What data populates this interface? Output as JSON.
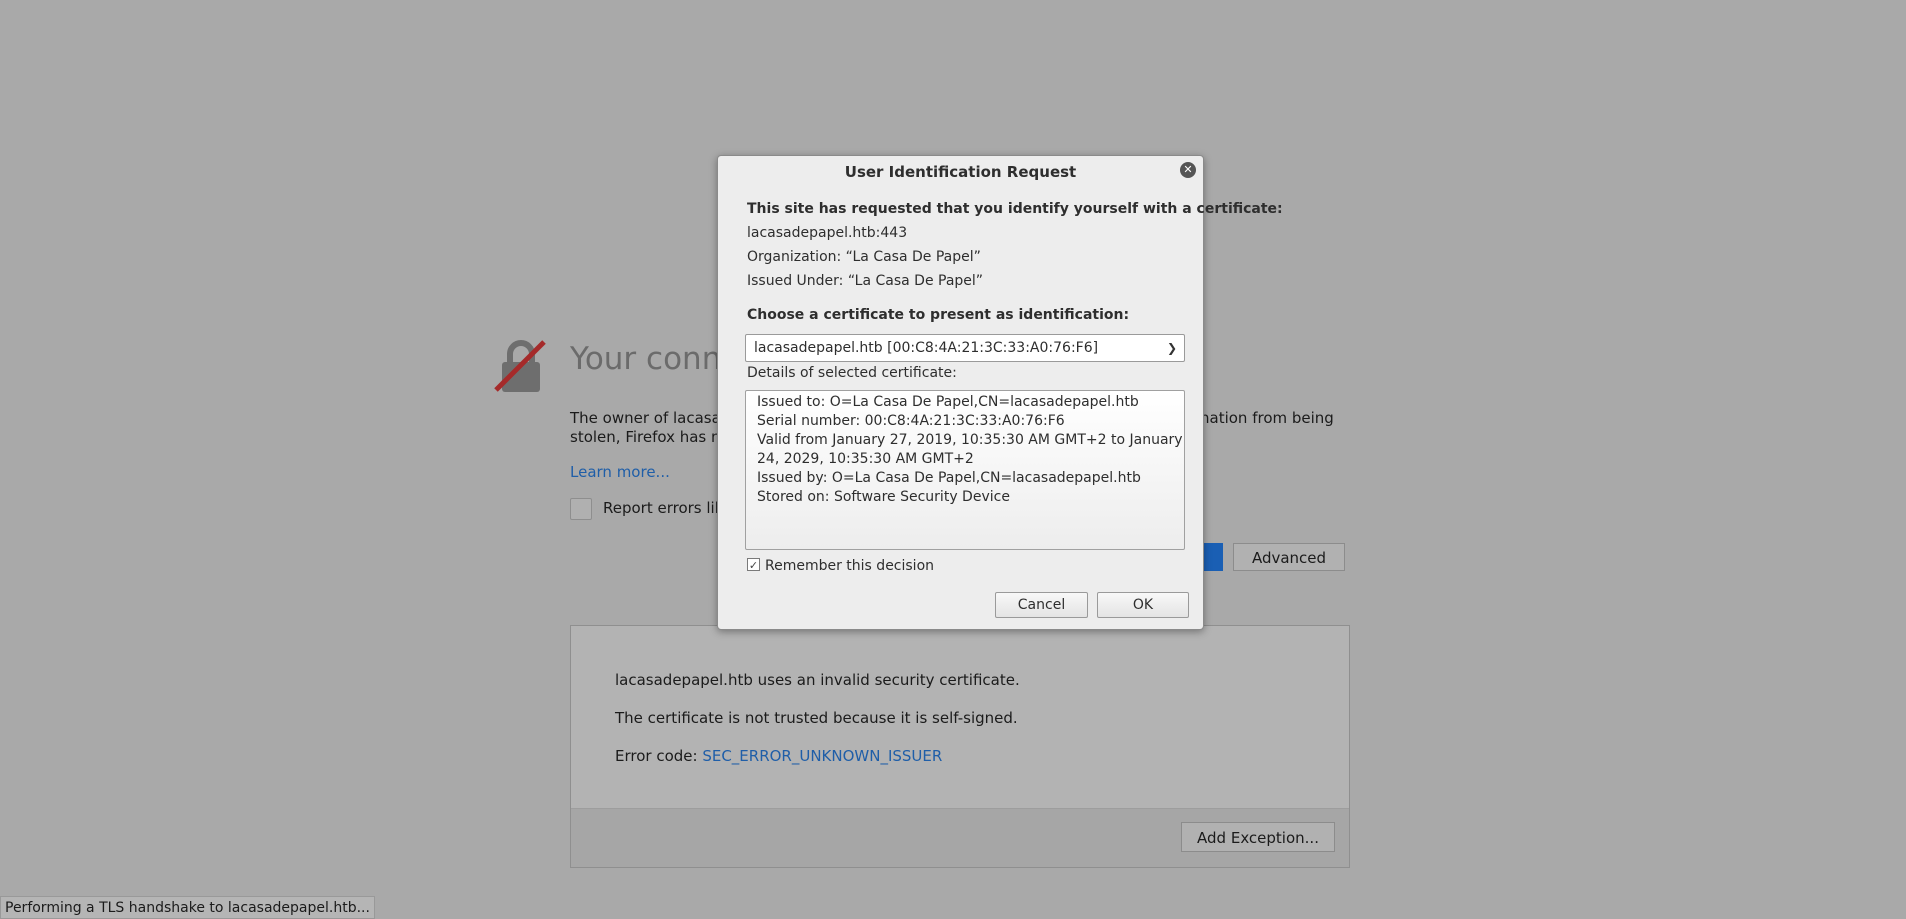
{
  "background": {
    "headline": "Your conne",
    "description_left": "The owner of lacasade",
    "description_left_2": "stolen, Firefox has not",
    "description_right": "nation from being",
    "learn_more": "Learn more...",
    "report_label": "Report errors like",
    "advanced_button": "Advanced",
    "panel": {
      "line1": "lacasadepapel.htb uses an invalid security certificate.",
      "line2": "The certificate is not trusted because it is self-signed.",
      "error_prefix": "Error code: ",
      "error_code": "SEC_ERROR_UNKNOWN_ISSUER",
      "add_exception_button": "Add Exception..."
    },
    "status_bar": "Performing a TLS handshake to lacasadepapel.htb..."
  },
  "dialog": {
    "title": "User Identification Request",
    "close_icon": "close-icon",
    "intro": "This site has requested that you identify yourself with a certificate:",
    "host": "lacasadepapel.htb:443",
    "organization": "Organization: “La Casa De Papel”",
    "issued_under": "Issued Under: “La Casa De Papel”",
    "choose_label": "Choose a certificate to present as identification:",
    "selected_certificate": "lacasadepapel.htb [00:C8:4A:21:3C:33:A0:76:F6]",
    "details_label": "Details of selected certificate:",
    "details": [
      "Issued to: O=La Casa De Papel,CN=lacasadepapel.htb",
      "Serial number: 00:C8:4A:21:3C:33:A0:76:F6",
      "Valid from January 27, 2019, 10:35:30 AM GMT+2 to January",
      "24, 2029, 10:35:30 AM GMT+2",
      "Issued by: O=La Casa De Papel,CN=lacasadepapel.htb",
      "Stored on: Software Security Device"
    ],
    "remember_label": "Remember this decision",
    "remember_checked": true,
    "cancel_button": "Cancel",
    "ok_button": "OK"
  }
}
